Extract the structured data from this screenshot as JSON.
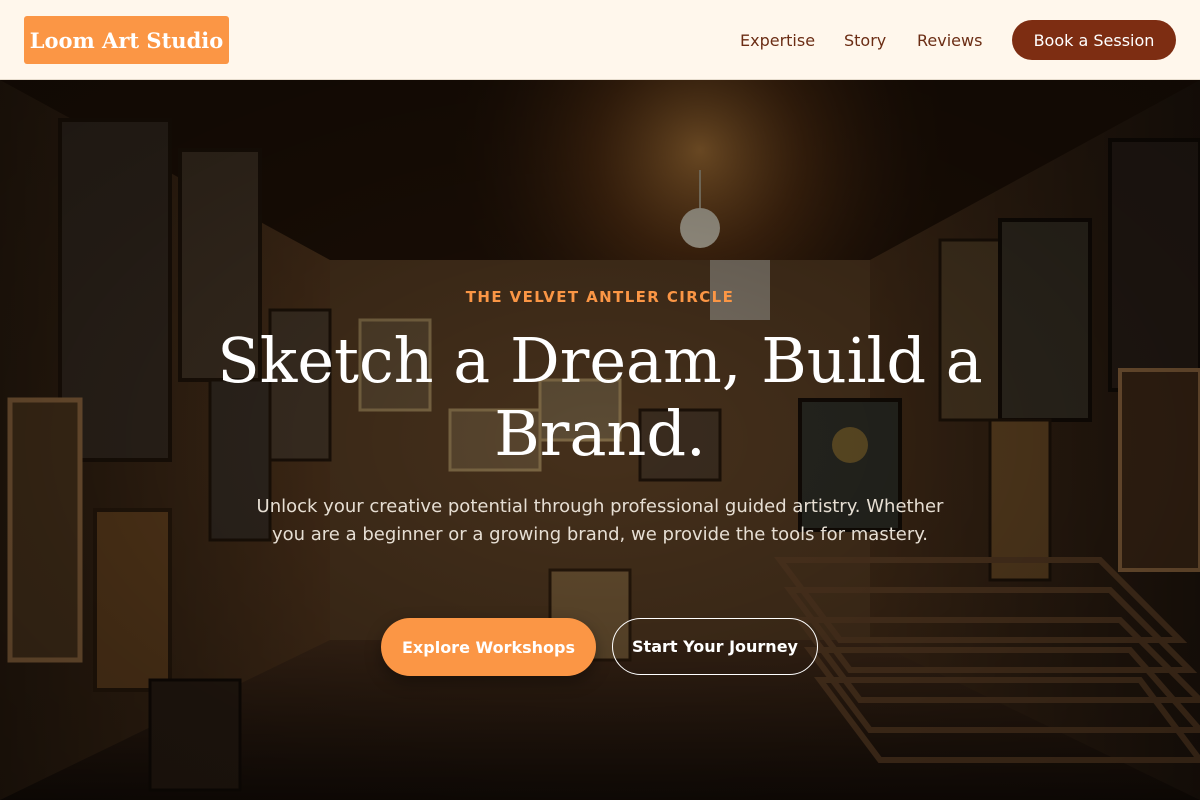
{
  "header": {
    "logo_text": "Loom Art Studio",
    "nav": [
      "Expertise",
      "Story",
      "Reviews"
    ],
    "cta_label": "Book a Session"
  },
  "hero": {
    "eyebrow": "THE VELVET ANTLER CIRCLE",
    "headline": "Sketch a Dream, Build a Brand.",
    "subtext": "Unlock your creative potential through professional guided artistry. Whether you are a beginner or a growing brand, we provide the tools for mastery.",
    "primary_button": "Explore Workshops",
    "secondary_button": "Start Your Journey",
    "background_description_icon": "art-gallery-background-image"
  },
  "colors": {
    "header_bg": "#fff7ec",
    "accent_orange": "#fb9645",
    "brand_brown": "#7d2d12",
    "nav_text": "#6b2d14"
  }
}
